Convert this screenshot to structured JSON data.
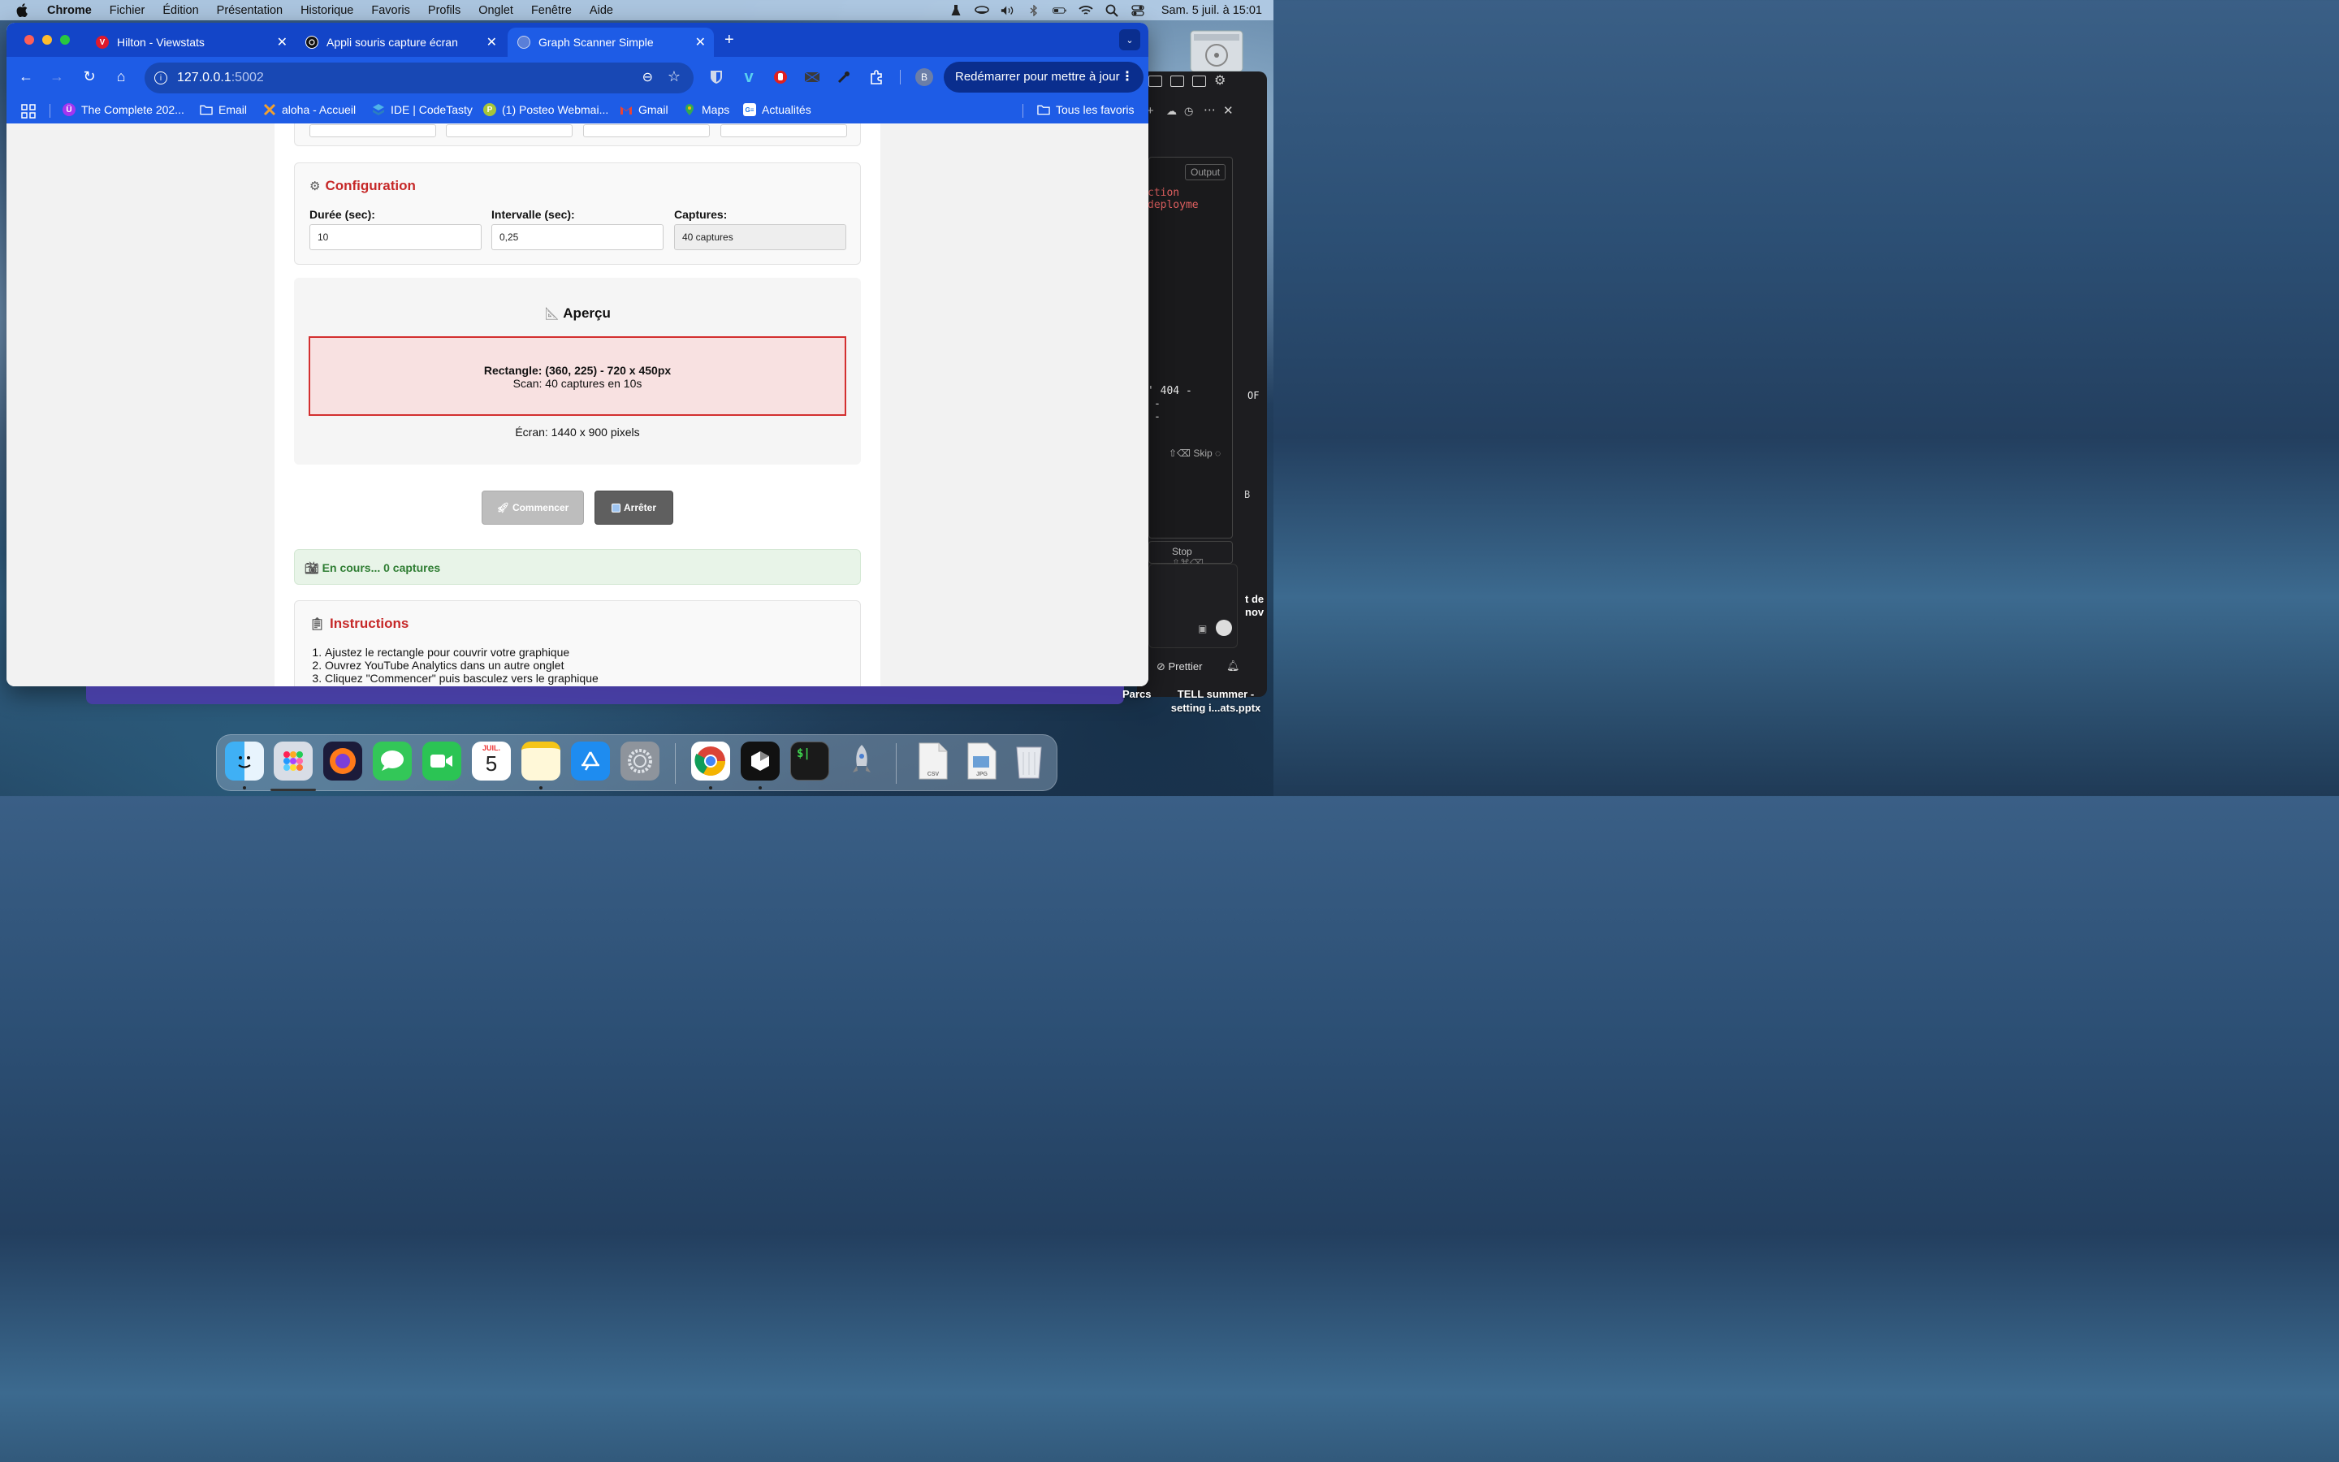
{
  "menubar": {
    "app_name": "Chrome",
    "items": [
      "Fichier",
      "Édition",
      "Présentation",
      "Historique",
      "Favoris",
      "Profils",
      "Onglet",
      "Fenêtre",
      "Aide"
    ],
    "clock": "Sam. 5 juil. à  15:01"
  },
  "tabs": [
    {
      "title": "Hilton - Viewstats",
      "favicon_letter": "V",
      "favicon_color": "#e0192c"
    },
    {
      "title": "Appli souris capture écran",
      "favicon_color": "#111111"
    },
    {
      "title": "Graph Scanner Simple",
      "favicon_color": "#5a7fd8",
      "active": true
    }
  ],
  "toolbar": {
    "url_host": "127.0.0.1",
    "url_port": ":5002",
    "profile_initial": "B",
    "restart_label": "Redémarrer pour mettre à jour"
  },
  "bookmarks": [
    {
      "label": "The Complete 202...",
      "icon": "udemy-icon",
      "color": "#a435f0",
      "glyph": "Ü"
    },
    {
      "label": "Email",
      "icon": "folder-icon"
    },
    {
      "label": "aloha - Accueil",
      "icon": "aloha-icon"
    },
    {
      "label": "IDE | CodeTasty",
      "icon": "codetasty-icon"
    },
    {
      "label": "(1) Posteo Webmai...",
      "icon": "posteo-icon",
      "color": "#a7c539",
      "glyph": "P"
    },
    {
      "label": "Gmail",
      "icon": "gmail-icon"
    },
    {
      "label": "Maps",
      "icon": "maps-icon"
    },
    {
      "label": "Actualités",
      "icon": "news-icon"
    }
  ],
  "all_bookmarks_label": "Tous les favoris",
  "config": {
    "title": "Configuration",
    "duration_label": "Durée (sec):",
    "duration_value": "10",
    "interval_label": "Intervalle (sec):",
    "interval_value": "0,25",
    "captures_label": "Captures:",
    "captures_value": "40 captures"
  },
  "preview": {
    "title": "Aperçu",
    "rect_line": "Rectangle: (360, 225) - 720 x 450px",
    "scan_line": "Scan: 40 captures en 10s",
    "screen_line": "Écran: 1440 x 900 pixels"
  },
  "actions": {
    "start_label": "Commencer",
    "stop_label": "Arrêter"
  },
  "status_text": "En cours... 0 captures",
  "instructions": {
    "title": "Instructions",
    "steps": [
      "Ajustez le rectangle pour couvrir votre graphique",
      "Ouvrez YouTube Analytics dans un autre onglet",
      "Cliquez \"Commencer\" puis basculez vers le graphique"
    ]
  },
  "editor": {
    "output_tab": "Output",
    "code_red": "ction deployme",
    "code_404": "' 404 -",
    "dash": "-",
    "skip_label": "Skip",
    "stop_label": "Stop",
    "stop_shortcut": "⇧⌘⌫",
    "prettier_label": "Prettier",
    "of_fragment": "OF",
    "b_fragment": "B",
    "de_fragment": "t de",
    "nov_fragment": "nov"
  },
  "desktop": {
    "parcs_label": "Parcs",
    "file_label_1": "TELL summer -",
    "file_label_2": "setting i...ats.pptx",
    "calendar_month": "JUIL.",
    "calendar_day": "5",
    "csv_label": "CSV",
    "jpg_label": "JPG"
  }
}
